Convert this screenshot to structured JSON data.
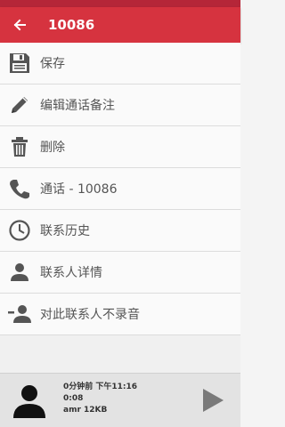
{
  "header": {
    "title": "10086",
    "back_icon": "arrow-left-icon",
    "bar_color": "#d6333f",
    "status_color": "#b52638"
  },
  "menu": {
    "items": [
      {
        "label": "保存",
        "icon": "save-icon"
      },
      {
        "label": "编辑通话备注",
        "icon": "pencil-icon"
      },
      {
        "label": "删除",
        "icon": "trash-icon"
      },
      {
        "label": "通话 - 10086",
        "icon": "phone-icon"
      },
      {
        "label": "联系历史",
        "icon": "clock-icon"
      },
      {
        "label": "联系人详情",
        "icon": "person-icon"
      },
      {
        "label": "对此联系人不录音",
        "icon": "person-remove-icon"
      }
    ]
  },
  "player": {
    "line1": "0分钟前 下午11:16",
    "line2": "0:08",
    "line3": "amr 12KB",
    "avatar_icon": "avatar-icon",
    "play_icon": "play-icon"
  }
}
